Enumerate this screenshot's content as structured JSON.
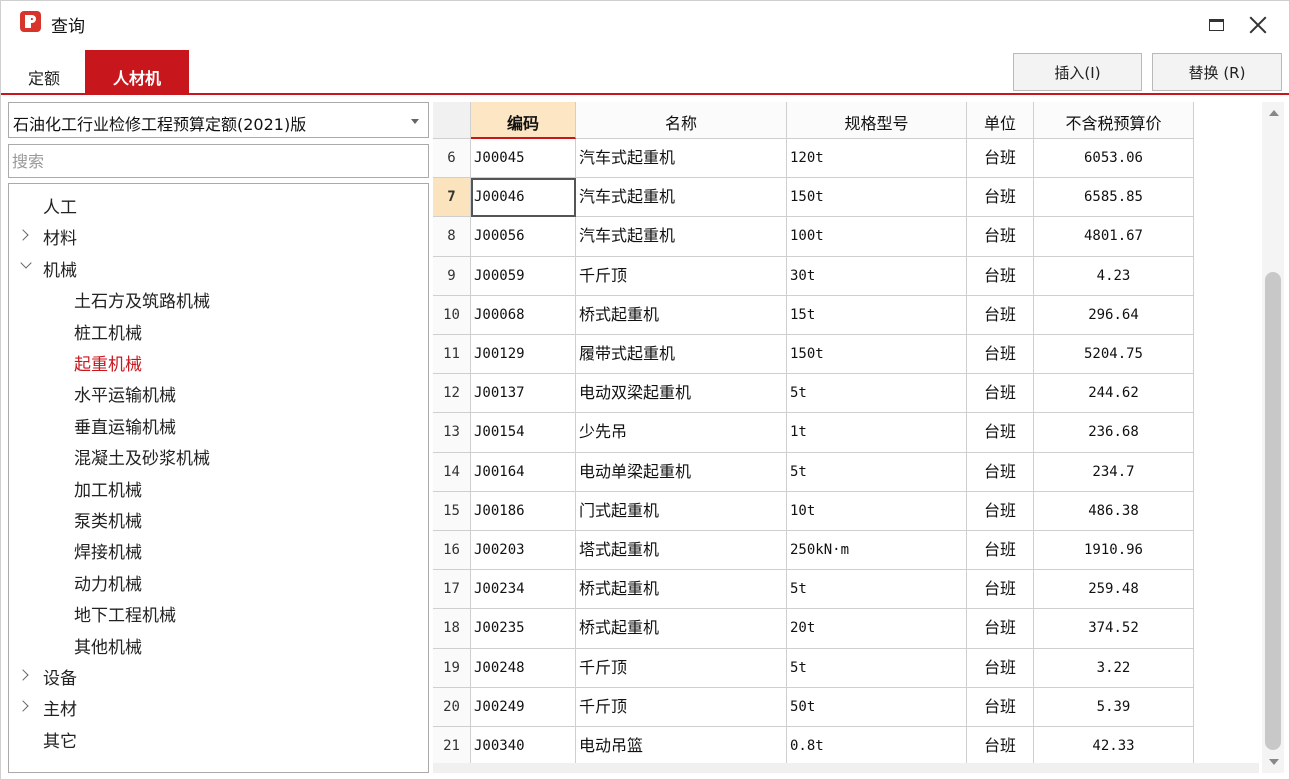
{
  "window": {
    "title": "查询"
  },
  "tabs": [
    {
      "label": "定额",
      "active": false
    },
    {
      "label": "人材机",
      "active": true
    }
  ],
  "toolbar": {
    "insert_label": "插入(I)",
    "replace_label": "替换 (R)"
  },
  "left": {
    "quota_select": "石油化工行业检修工程预算定额(2021)版",
    "search_placeholder": "搜索",
    "tree": [
      {
        "label": "人工",
        "level": 0,
        "expander": "none",
        "selected": false
      },
      {
        "label": "材料",
        "level": 0,
        "expander": "collapsed",
        "selected": false
      },
      {
        "label": "机械",
        "level": 0,
        "expander": "expanded",
        "selected": false
      },
      {
        "label": "土石方及筑路机械",
        "level": 1,
        "expander": "none",
        "selected": false
      },
      {
        "label": "桩工机械",
        "level": 1,
        "expander": "none",
        "selected": false
      },
      {
        "label": "起重机械",
        "level": 1,
        "expander": "none",
        "selected": true
      },
      {
        "label": "水平运输机械",
        "level": 1,
        "expander": "none",
        "selected": false
      },
      {
        "label": "垂直运输机械",
        "level": 1,
        "expander": "none",
        "selected": false
      },
      {
        "label": "混凝土及砂浆机械",
        "level": 1,
        "expander": "none",
        "selected": false
      },
      {
        "label": "加工机械",
        "level": 1,
        "expander": "none",
        "selected": false
      },
      {
        "label": "泵类机械",
        "level": 1,
        "expander": "none",
        "selected": false
      },
      {
        "label": "焊接机械",
        "level": 1,
        "expander": "none",
        "selected": false
      },
      {
        "label": "动力机械",
        "level": 1,
        "expander": "none",
        "selected": false
      },
      {
        "label": "地下工程机械",
        "level": 1,
        "expander": "none",
        "selected": false
      },
      {
        "label": "其他机械",
        "level": 1,
        "expander": "none",
        "selected": false
      },
      {
        "label": "设备",
        "level": 0,
        "expander": "collapsed",
        "selected": false
      },
      {
        "label": "主材",
        "level": 0,
        "expander": "collapsed",
        "selected": false
      },
      {
        "label": "其它",
        "level": 0,
        "expander": "none",
        "selected": false
      }
    ]
  },
  "grid": {
    "columns": [
      "编码",
      "名称",
      "规格型号",
      "单位",
      "不含税预算价"
    ],
    "current_row": "7",
    "rows": [
      {
        "no": "6",
        "code": "J00045",
        "name": "汽车式起重机",
        "spec": "120t",
        "unit": "台班",
        "price": "6053.06"
      },
      {
        "no": "7",
        "code": "J00046",
        "name": "汽车式起重机",
        "spec": "150t",
        "unit": "台班",
        "price": "6585.85"
      },
      {
        "no": "8",
        "code": "J00056",
        "name": "汽车式起重机",
        "spec": "100t",
        "unit": "台班",
        "price": "4801.67"
      },
      {
        "no": "9",
        "code": "J00059",
        "name": "千斤顶",
        "spec": "30t",
        "unit": "台班",
        "price": "4.23"
      },
      {
        "no": "10",
        "code": "J00068",
        "name": "桥式起重机",
        "spec": "15t",
        "unit": "台班",
        "price": "296.64"
      },
      {
        "no": "11",
        "code": "J00129",
        "name": "履带式起重机",
        "spec": "150t",
        "unit": "台班",
        "price": "5204.75"
      },
      {
        "no": "12",
        "code": "J00137",
        "name": "电动双梁起重机",
        "spec": "5t",
        "unit": "台班",
        "price": "244.62"
      },
      {
        "no": "13",
        "code": "J00154",
        "name": "少先吊",
        "spec": "1t",
        "unit": "台班",
        "price": "236.68"
      },
      {
        "no": "14",
        "code": "J00164",
        "name": "电动单梁起重机",
        "spec": "5t",
        "unit": "台班",
        "price": "234.7"
      },
      {
        "no": "15",
        "code": "J00186",
        "name": "门式起重机",
        "spec": "10t",
        "unit": "台班",
        "price": "486.38"
      },
      {
        "no": "16",
        "code": "J00203",
        "name": "塔式起重机",
        "spec": "250kN·m",
        "unit": "台班",
        "price": "1910.96"
      },
      {
        "no": "17",
        "code": "J00234",
        "name": "桥式起重机",
        "spec": "5t",
        "unit": "台班",
        "price": "259.48"
      },
      {
        "no": "18",
        "code": "J00235",
        "name": "桥式起重机",
        "spec": "20t",
        "unit": "台班",
        "price": "374.52"
      },
      {
        "no": "19",
        "code": "J00248",
        "name": "千斤顶",
        "spec": "5t",
        "unit": "台班",
        "price": "3.22"
      },
      {
        "no": "20",
        "code": "J00249",
        "name": "千斤顶",
        "spec": "50t",
        "unit": "台班",
        "price": "5.39"
      },
      {
        "no": "21",
        "code": "J00340",
        "name": "电动吊篮",
        "spec": "0.8t",
        "unit": "台班",
        "price": "42.33"
      }
    ]
  },
  "colors": {
    "accent": "#c8161d",
    "header_active": "#fde6c4",
    "current_row": "#fbe3be"
  }
}
